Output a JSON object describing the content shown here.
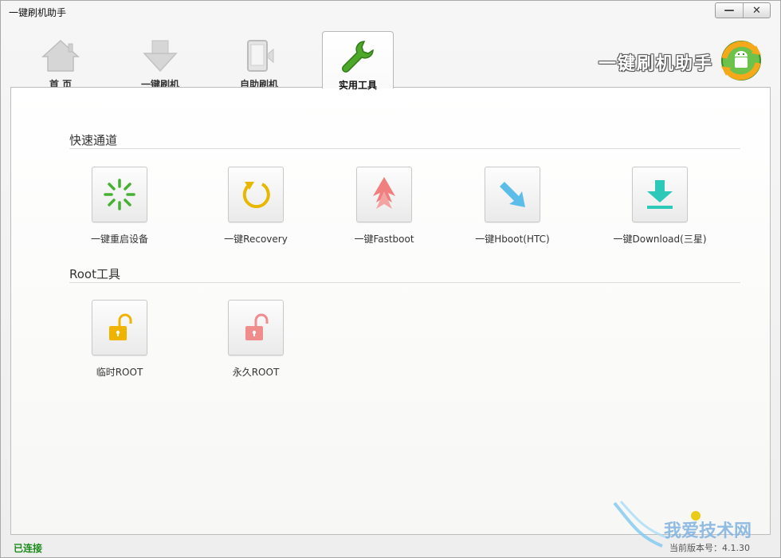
{
  "window": {
    "title": "一键刷机助手",
    "minimize_symbol": "—",
    "close_symbol": "✕"
  },
  "tabs": [
    {
      "label": "首 页",
      "icon": "home-icon",
      "active": false
    },
    {
      "label": "一键刷机",
      "icon": "download-arrow-icon",
      "active": false
    },
    {
      "label": "自助刷机",
      "icon": "phone-icon",
      "active": false
    },
    {
      "label": "实用工具",
      "icon": "wrench-icon",
      "active": true
    }
  ],
  "brand": {
    "text": "一键刷机助手",
    "logo_icon": "android-refresh-logo"
  },
  "sections": {
    "quick": {
      "title": "快速通道",
      "items": [
        {
          "label": "一键重启设备",
          "icon": "loading-spinner-icon",
          "color": "#46b033"
        },
        {
          "label": "一键Recovery",
          "icon": "refresh-circle-icon",
          "color": "#e8b800"
        },
        {
          "label": "一键Fastboot",
          "icon": "up-arrow-icon",
          "color": "#f08080"
        },
        {
          "label": "一键Hboot(HTC)",
          "icon": "diagonal-arrow-icon",
          "color": "#5bbde8"
        },
        {
          "label": "一键Download(三星)",
          "icon": "download-tray-icon",
          "color": "#2cc9b8"
        }
      ]
    },
    "root": {
      "title": "Root工具",
      "items": [
        {
          "label": "临时ROOT",
          "icon": "unlock-yellow-icon",
          "color": "#f0b400"
        },
        {
          "label": "永久ROOT",
          "icon": "unlock-pink-icon",
          "color": "#f08c8c"
        }
      ]
    }
  },
  "status": {
    "connection": "已连接",
    "version": "当前版本号：4.1.30"
  },
  "watermark": {
    "text": "我爱技术网"
  }
}
